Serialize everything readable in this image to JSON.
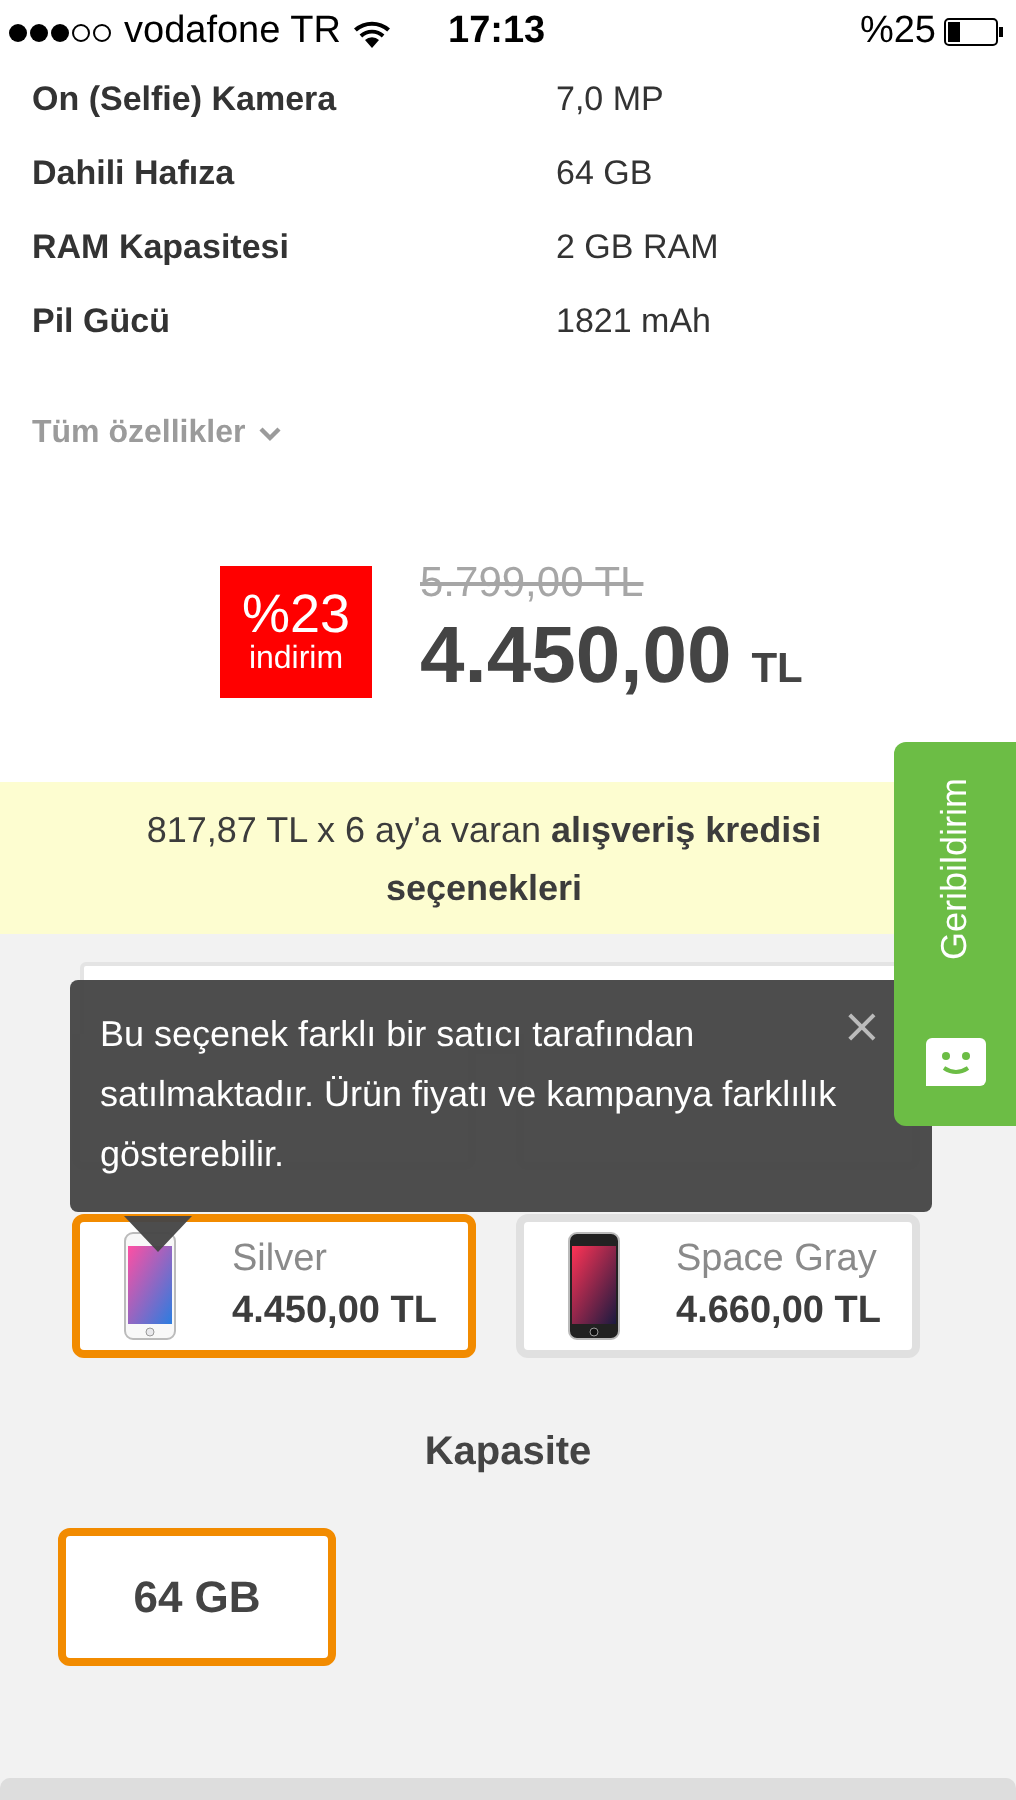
{
  "status_bar": {
    "carrier": "vodafone TR",
    "time": "17:13",
    "battery": "%25"
  },
  "specs": [
    {
      "label": "On (Selfie) Kamera",
      "value": "7,0 MP"
    },
    {
      "label": "Dahili Hafıza",
      "value": "64 GB"
    },
    {
      "label": "RAM Kapasitesi",
      "value": "2 GB RAM"
    },
    {
      "label": "Pil Gücü",
      "value": "1821 mAh"
    }
  ],
  "all_specs_link": "Tüm özellikler",
  "price": {
    "discount": "%23",
    "discount_label": "indirim",
    "old_price": "5.799,00 TL",
    "price": "4.450,00",
    "currency": "TL"
  },
  "credit_banner": "817,87 TL x 6 ay’a varan **alışveriş kredisi seçenekleri**",
  "tooltip": {
    "text": "Bu seçenek farklı bir satıcı tarafından satılmaktadır. Ürün fiyatı ve kampanya farklılık gösterebilir.",
    "close": "×"
  },
  "colors": [
    {
      "name": "Silver",
      "price": "4.450,00 TL",
      "selected": true,
      "kind": "silver"
    },
    {
      "name": "Space Gray",
      "price": "4.660,00 TL",
      "selected": false,
      "kind": "gray"
    }
  ],
  "capacity": {
    "title": "Kapasite",
    "options": [
      {
        "label": "64 GB",
        "selected": true
      }
    ]
  },
  "feedback_tab": {
    "label": "Geribildirim"
  }
}
